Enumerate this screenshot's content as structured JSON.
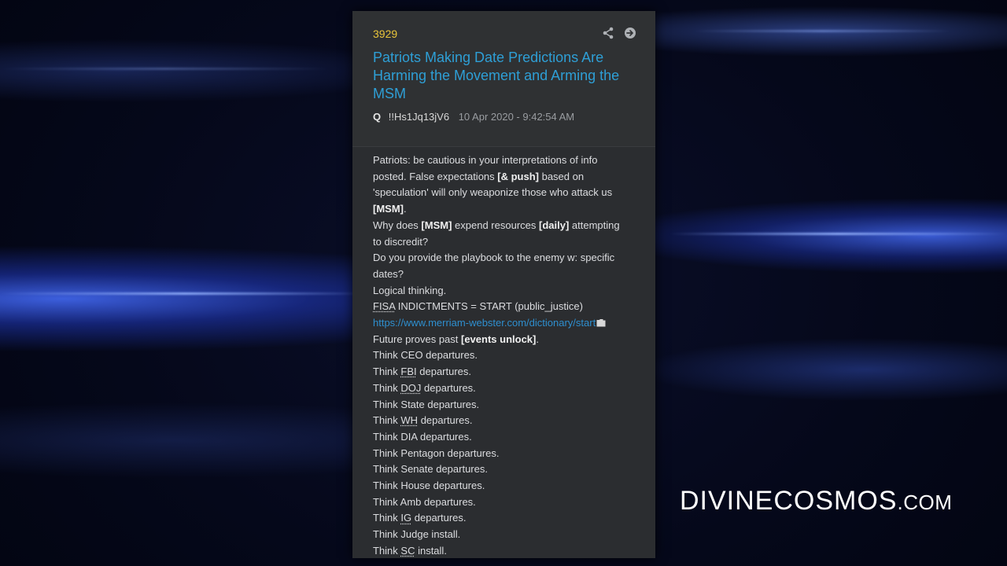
{
  "post": {
    "number": "3929",
    "title": "Patriots Making Date Predictions Are Harming the Movement and Arming the MSM",
    "author": "Q",
    "tripcode": "!!Hs1Jq13jV6",
    "date": "10 Apr 2020 - 9:42:54 AM",
    "icons": [
      "share-icon",
      "arrow-right-circle-icon"
    ],
    "body": {
      "l1": "Patriots: be cautious in your interpretations of info",
      "l2a": "posted. False expectations ",
      "l2b": "[& push]",
      "l2c": " based on",
      "l3": "'speculation' will only weaponize those who attack us",
      "l4a": "[MSM]",
      "l4b": ".",
      "l5a": "Why does ",
      "l5b": "[MSM]",
      "l5c": " expend resources ",
      "l5d": "[daily]",
      "l5e": " attempting",
      "l6": "to discredit?",
      "l7": "Do you provide the playbook to the enemy w: specific",
      "l8": "dates?",
      "l9": "Logical thinking.",
      "l10a": "FISA",
      "l10b": " INDICTMENTS = START (public_justice)",
      "l11": "https://www.merriam-webster.com/dictionary/start",
      "l12a": "Future proves past ",
      "l12b": "[events unlock]",
      "l12c": ".",
      "l13": "Think CEO departures.",
      "l14a": "Think ",
      "l14b": "FBI",
      "l14c": " departures.",
      "l15a": "Think ",
      "l15b": "DOJ",
      "l15c": " departures.",
      "l16": "Think State departures.",
      "l17a": "Think ",
      "l17b": "WH",
      "l17c": " departures.",
      "l18": "Think DIA departures.",
      "l19": "Think Pentagon departures.",
      "l20": "Think Senate departures.",
      "l21": "Think House departures.",
      "l22": "Think Amb departures.",
      "l23a": "Think ",
      "l23b": "IG",
      "l23c": " departures.",
      "l24": "Think Judge install.",
      "l25a": "Think ",
      "l25b": "SC",
      "l25c": " install."
    }
  },
  "watermark": {
    "main": "DIVINECOSMOS",
    "tld": ".COM"
  },
  "colors": {
    "post_number": "#e8c43a",
    "title": "#2e9fd6",
    "link": "#2e8fcf",
    "card_bg": "#2b2d30",
    "text": "#dcdde0"
  }
}
